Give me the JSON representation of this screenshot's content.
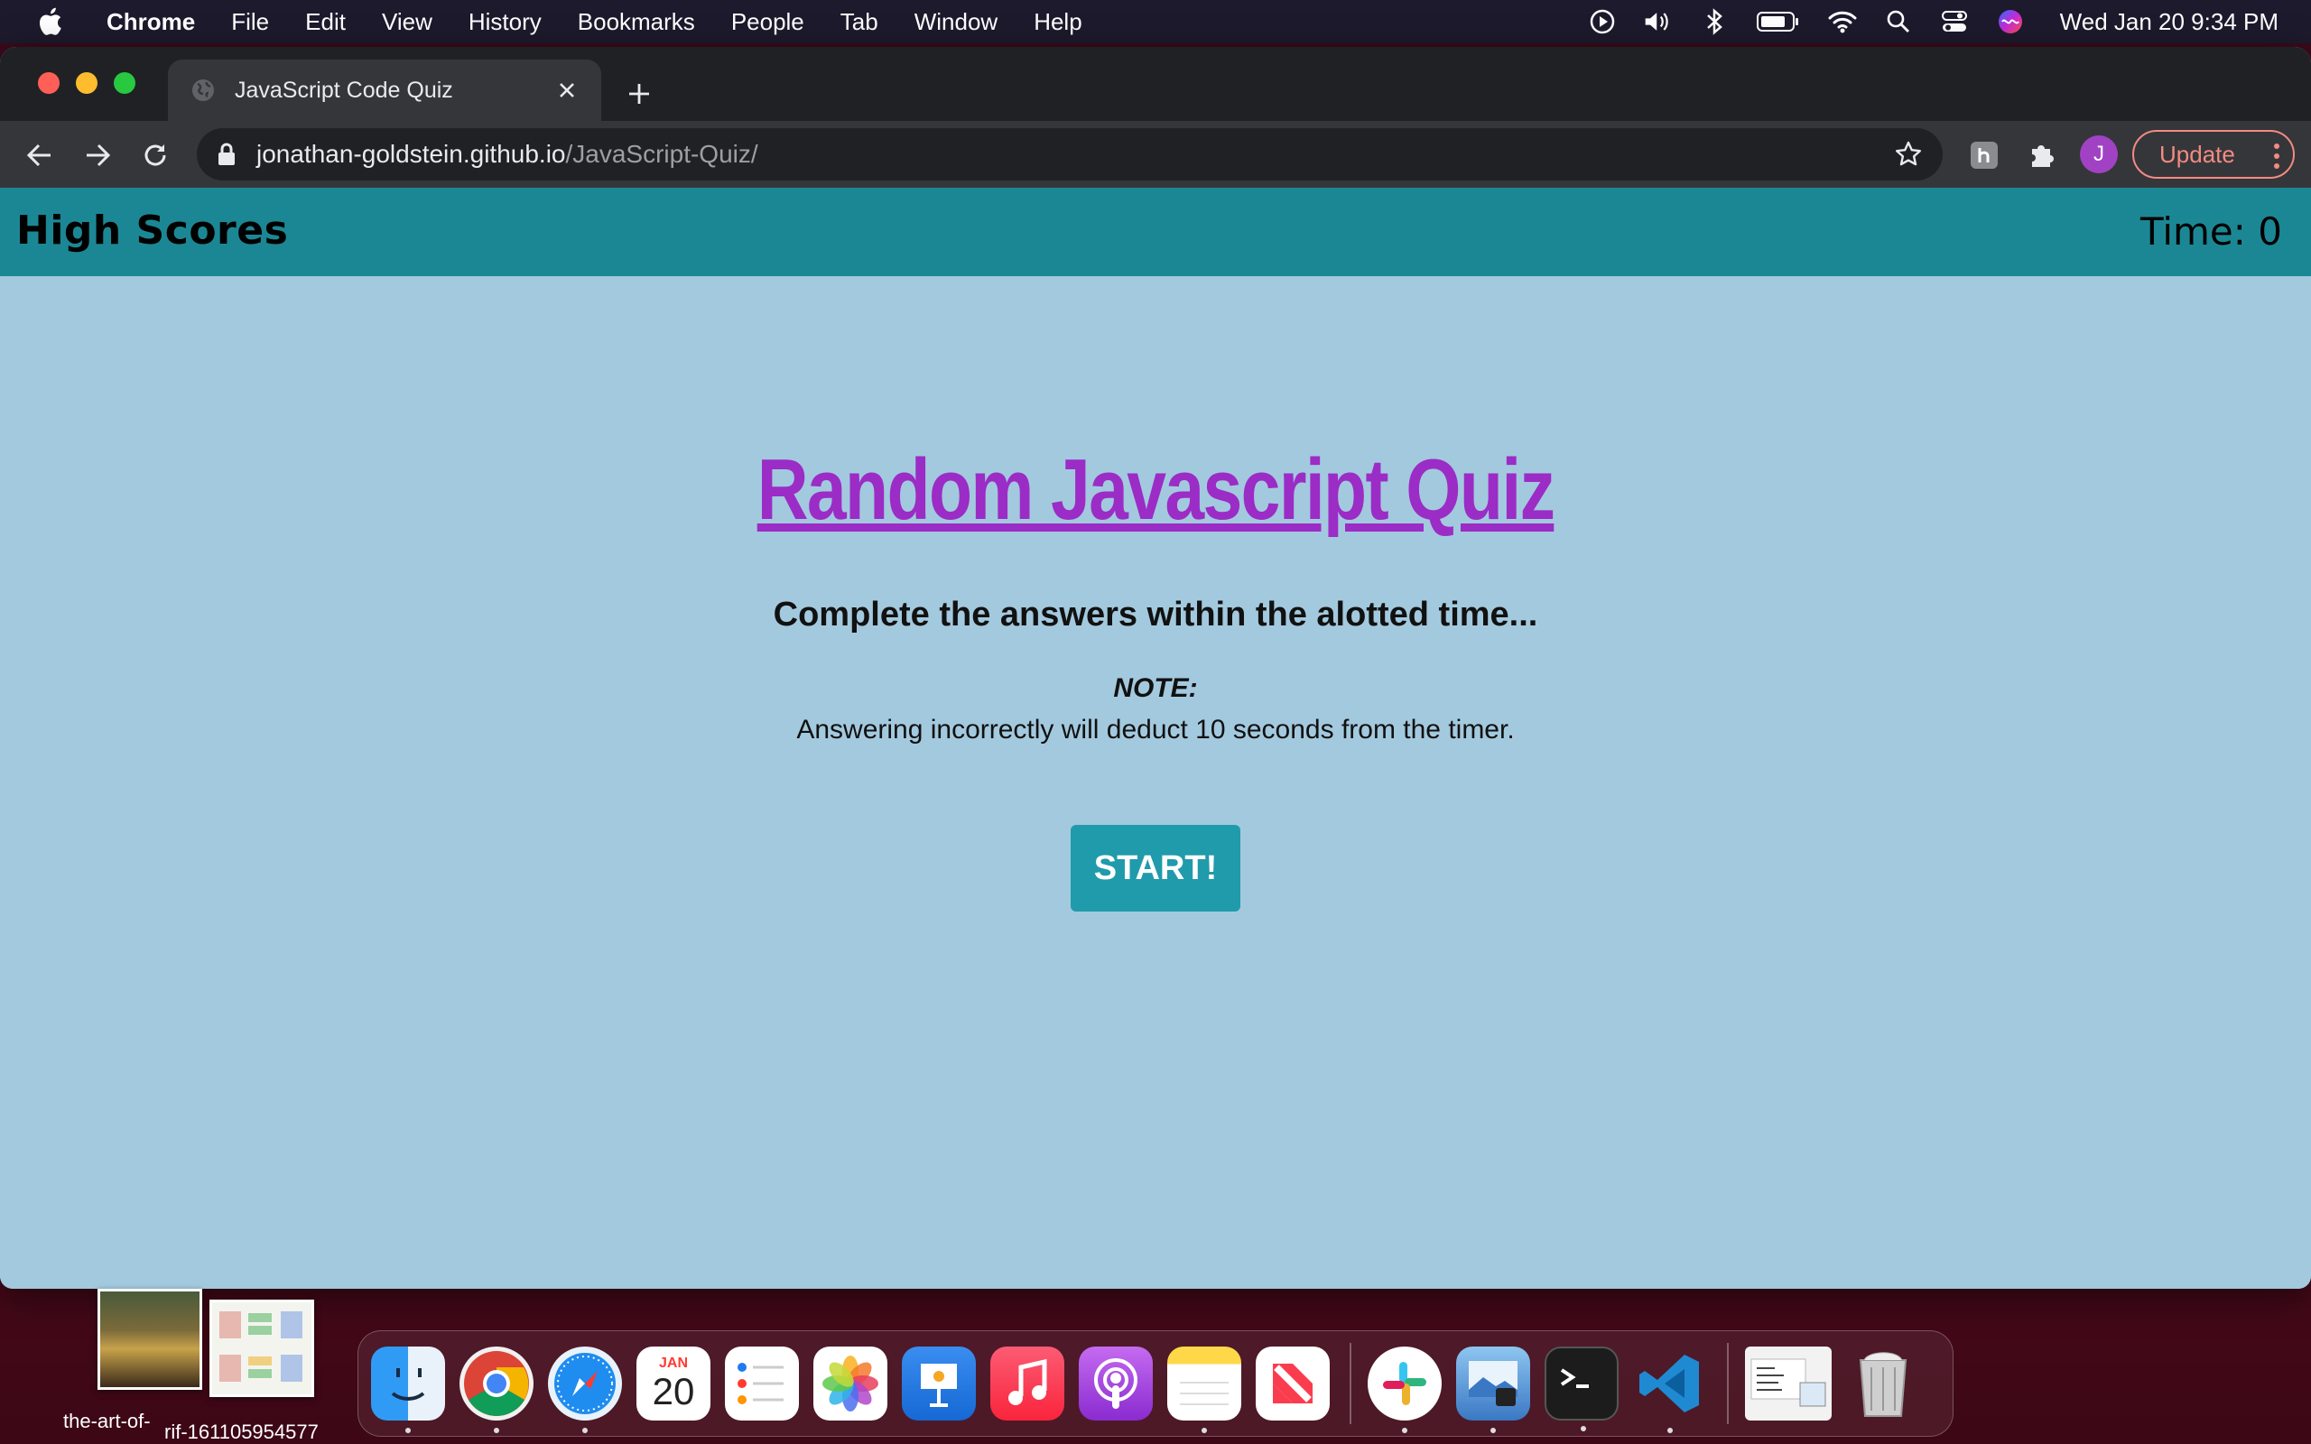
{
  "menubar": {
    "app": "Chrome",
    "items": [
      "File",
      "Edit",
      "View",
      "History",
      "Bookmarks",
      "People",
      "Tab",
      "Window",
      "Help"
    ],
    "clock": "Wed Jan 20  9:34 PM"
  },
  "browser": {
    "tab_title": "JavaScript Code Quiz",
    "url_host": "jonathan-goldstein.github.io",
    "url_path": "/JavaScript-Quiz/",
    "profile_initial": "J",
    "update_label": "Update"
  },
  "page": {
    "high_scores_link": "High Scores",
    "timer": "Time: 0",
    "title": "Random Javascript Quiz",
    "subtitle": "Complete the answers within the alotted time...",
    "note_label": "NOTE:",
    "note_text": "Answering incorrectly will deduct 10 seconds from the timer.",
    "start_button": "START!"
  },
  "desktop": {
    "file1": "the-art-of-",
    "file2": "rif-161105954577"
  },
  "dock": {
    "apps": [
      "Finder",
      "Chrome",
      "Safari",
      "Calendar",
      "Reminders",
      "Photos",
      "Keynote",
      "Music",
      "Podcasts",
      "Notes",
      "News",
      "Slack",
      "Preview",
      "Terminal",
      "Visual Studio Code",
      "Downloads",
      "Trash"
    ],
    "calendar_month": "JAN",
    "calendar_day": "20"
  },
  "colors": {
    "header_bg": "#1c8794",
    "page_bg": "#a3c9de",
    "title_color": "#9b2cc6",
    "start_button_bg": "#209bab"
  }
}
